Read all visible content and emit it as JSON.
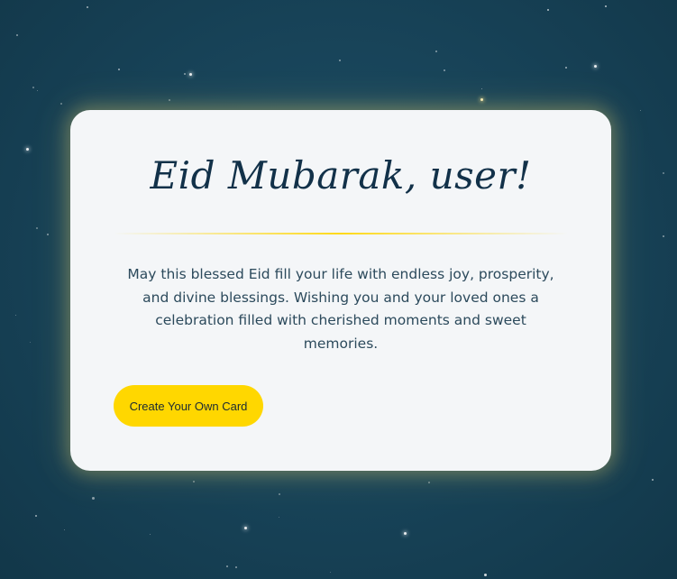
{
  "colors": {
    "background": "#174257",
    "card": "#f4f6f8",
    "title": "#123149",
    "text": "#2c4a5c",
    "accent": "#ffd700"
  },
  "card": {
    "title": "Eid Mubarak, user!",
    "message": "May this blessed Eid fill your life with endless joy, prosperity, and divine blessings. Wishing you and your loved ones a celebration filled with cherished moments and sweet memories.",
    "cta_label": "Create Your Own Card"
  }
}
